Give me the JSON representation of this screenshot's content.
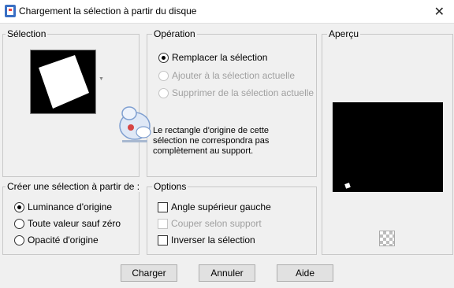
{
  "window": {
    "title": "Chargement la sélection à partir du disque",
    "close_glyph": "✕"
  },
  "selection_group": {
    "title": "Sélection",
    "dropdown_glyph": "▼"
  },
  "operation_group": {
    "title": "Opération",
    "options": [
      {
        "label": "Remplacer la sélection",
        "checked": true,
        "enabled": true
      },
      {
        "label": "Ajouter à la sélection actuelle",
        "checked": false,
        "enabled": false
      },
      {
        "label": "Supprimer de la sélection actuelle",
        "checked": false,
        "enabled": false
      }
    ],
    "message": "Le rectangle d'origine de cette sélection ne correspondra pas complètement au support."
  },
  "create_group": {
    "title": "Créer une sélection à partir de :",
    "options": [
      {
        "label": "Luminance d'origine",
        "checked": true
      },
      {
        "label": "Toute valeur sauf zéro",
        "checked": false
      },
      {
        "label": "Opacité d'origine",
        "checked": false
      }
    ]
  },
  "options_group": {
    "title": "Options",
    "checks": [
      {
        "label": "Angle supérieur gauche",
        "checked": false,
        "enabled": true
      },
      {
        "label": "Couper selon support",
        "checked": false,
        "enabled": false
      },
      {
        "label": "Inverser la sélection",
        "checked": false,
        "enabled": true
      }
    ]
  },
  "preview_group": {
    "title": "Aperçu"
  },
  "buttons": {
    "ok": "Charger",
    "cancel": "Annuler",
    "help": "Aide"
  },
  "colors": {
    "warning_icon": "#d64545",
    "preview_bg": "#000000"
  }
}
